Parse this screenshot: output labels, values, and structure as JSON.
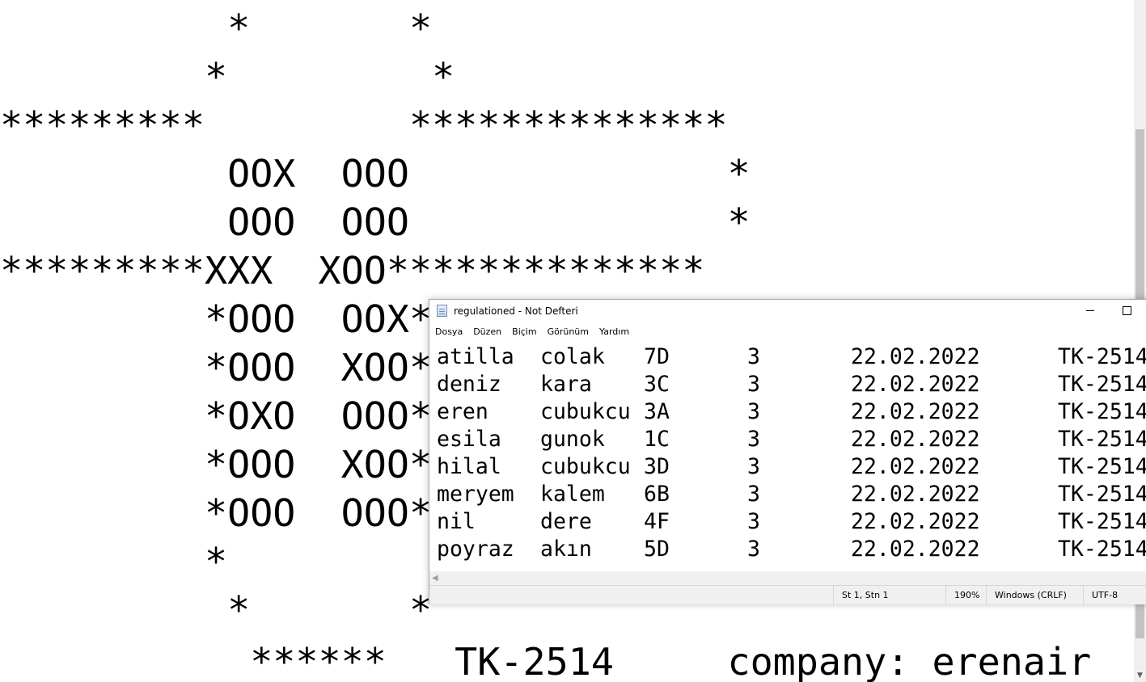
{
  "console": {
    "art_lines": [
      "          *       *",
      "         *         *",
      "*********         **************",
      "          OOX  OOO              *",
      "          OOO  OOO              *",
      "*********XXX  XOO**************",
      "         *OOO  OOX*",
      "         *OOO  XOO*",
      "         *OXO  OOO*",
      "         *OOO  XOO*",
      "         *OOO  OOO*",
      "         *         *",
      "          *       *"
    ],
    "bottom_line": "           ******   TK-2514     company: erenair"
  },
  "notepad": {
    "title": "regulationed - Not Defteri",
    "menu": [
      "Dosya",
      "Düzen",
      "Biçim",
      "Görünüm",
      "Yardım"
    ],
    "rows": [
      [
        "atilla",
        "colak",
        "7D",
        "3",
        "22.02.2022",
        "TK-2514"
      ],
      [
        "deniz",
        "kara",
        "3C",
        "3",
        "22.02.2022",
        "TK-2514"
      ],
      [
        "eren",
        "cubukcu",
        "3A",
        "3",
        "22.02.2022",
        "TK-2514"
      ],
      [
        "esila",
        "gunok",
        "1C",
        "3",
        "22.02.2022",
        "TK-2514"
      ],
      [
        "hilal",
        "cubukcu",
        "3D",
        "3",
        "22.02.2022",
        "TK-2514"
      ],
      [
        "meryem",
        "kalem",
        "6B",
        "3",
        "22.02.2022",
        "TK-2514"
      ],
      [
        "nil",
        "dere",
        "4F",
        "3",
        "22.02.2022",
        "TK-2514"
      ],
      [
        "poyraz",
        "akın",
        "5D",
        "3",
        "22.02.2022",
        "TK-2514"
      ]
    ],
    "status": {
      "position": "St 1, Stn 1",
      "zoom": "190%",
      "line_ending": "Windows (CRLF)",
      "encoding": "UTF-8"
    }
  }
}
